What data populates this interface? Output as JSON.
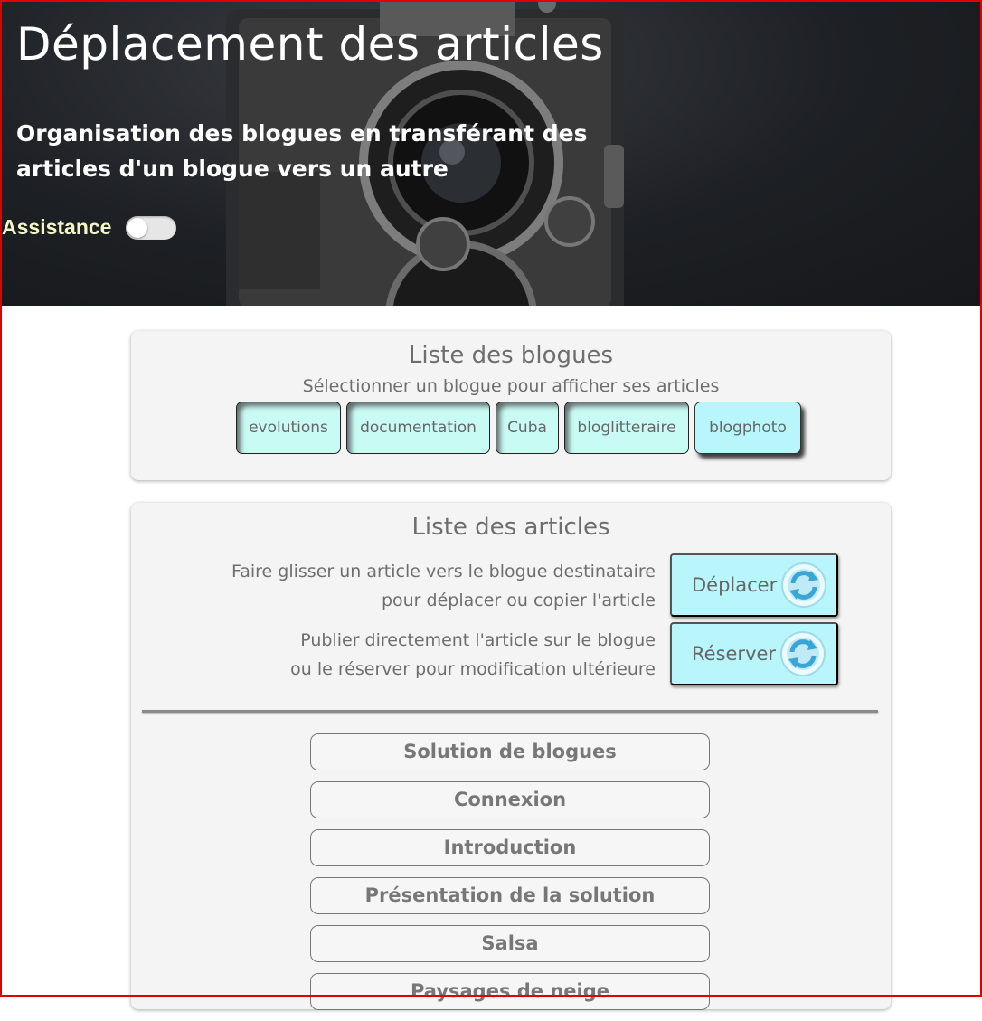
{
  "header": {
    "title": "Déplacement des articles",
    "subtitle": "Organisation des blogues en transférant des articles d'un blogue vers un autre",
    "assist_label": "Assistance"
  },
  "blogs_panel": {
    "title": "Liste des blogues",
    "subtitle": "Sélectionner un blogue pour afficher ses articles",
    "blogs": [
      {
        "label": "evolutions"
      },
      {
        "label": "documentation"
      },
      {
        "label": "Cuba"
      },
      {
        "label": "bloglitteraire"
      },
      {
        "label": "blogphoto"
      }
    ],
    "selected": "blogphoto"
  },
  "articles_panel": {
    "title": "Liste des articles",
    "instruction_move_1": "Faire glisser un article vers le blogue destinataire",
    "instruction_move_2": "pour déplacer ou copier l'article",
    "move_label": "Déplacer",
    "instruction_publish_1": "Publier directement l'article sur le blogue",
    "instruction_publish_2": "ou le réserver pour modification ultérieure",
    "reserve_label": "Réserver",
    "articles": [
      {
        "label": "Solution de blogues"
      },
      {
        "label": "Connexion"
      },
      {
        "label": "Introduction"
      },
      {
        "label": "Présentation de la solution"
      },
      {
        "label": "Salsa"
      },
      {
        "label": "Paysages de neige"
      }
    ]
  },
  "colors": {
    "accent_button": "#b8f6fb",
    "blog_button": "#c9fbf5",
    "frame_border": "#e00000"
  }
}
